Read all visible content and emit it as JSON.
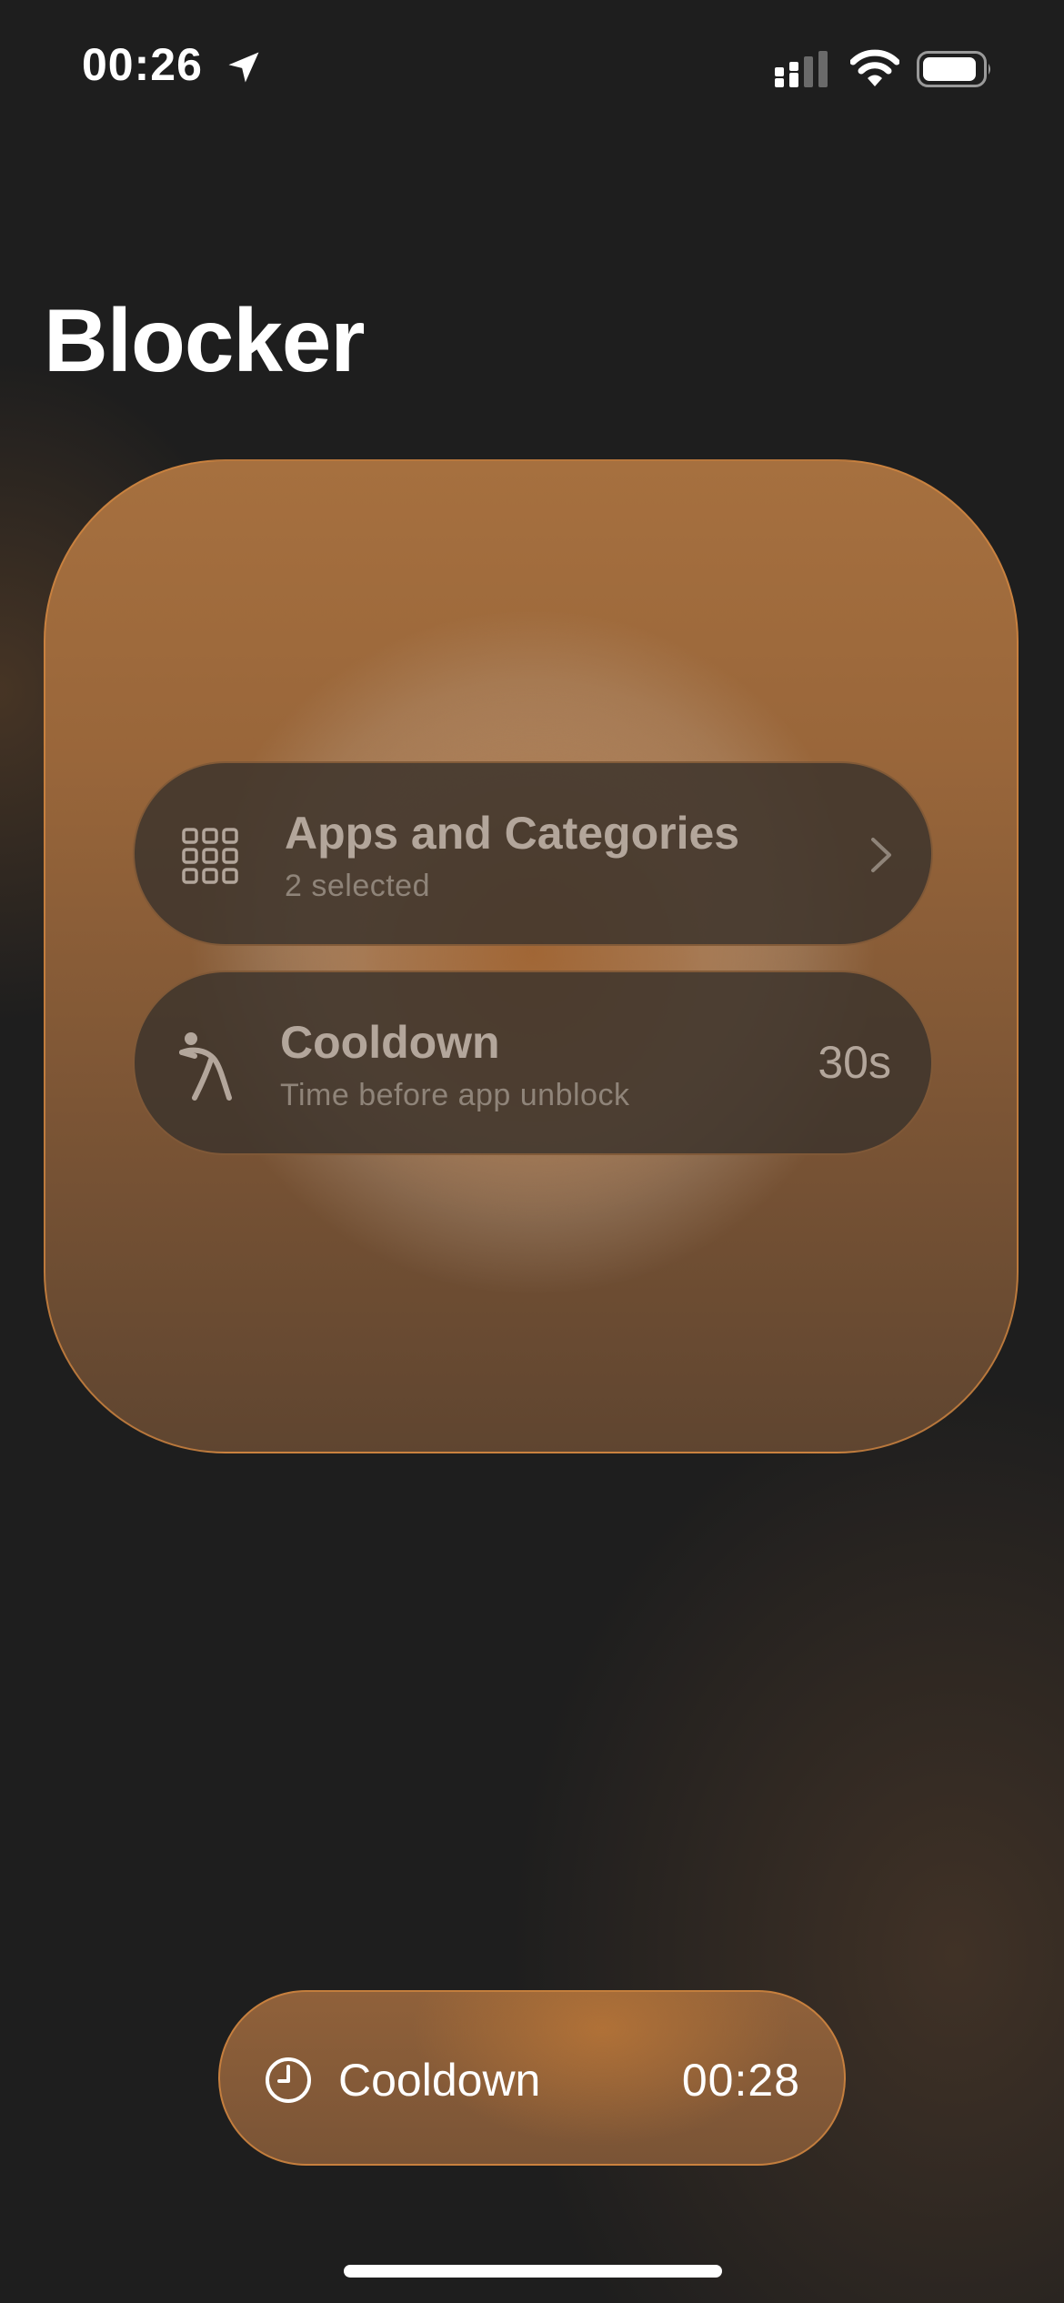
{
  "status_bar": {
    "time": "00:26",
    "icons": [
      "location-arrow-icon",
      "cellular-signal-icon",
      "wifi-icon",
      "battery-icon"
    ]
  },
  "page": {
    "title": "Blocker"
  },
  "card": {
    "apps_row": {
      "icon": "grid-icon",
      "title": "Apps and Categories",
      "subtitle": "2 selected",
      "trailing_icon": "chevron-right-icon"
    },
    "cooldown_row": {
      "icon": "stretching-figure-icon",
      "title": "Cooldown",
      "subtitle": "Time before app unblock",
      "value": "30s"
    }
  },
  "cooldown_pill": {
    "icon": "clock-icon",
    "label": "Cooldown",
    "timer": "00:28"
  },
  "colors": {
    "background": "#1e1e1e",
    "accent": "#a6703f",
    "accent_border": "#d68840",
    "row_bg": "#3e342c",
    "row_text": "#b3a69b",
    "row_subtext": "#8f8479"
  }
}
